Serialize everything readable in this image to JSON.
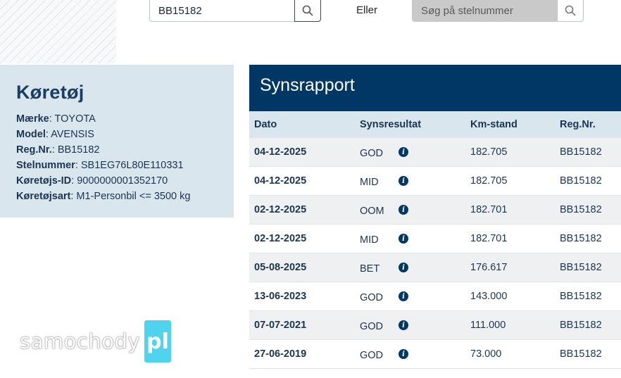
{
  "search": {
    "reg_value": "BB15182",
    "or_label": "Eller",
    "frame_placeholder": "Søg på stelnummer"
  },
  "vehicle": {
    "title": "Køretøj",
    "fields": [
      {
        "key": "Mærke",
        "value": "TOYOTA"
      },
      {
        "key": "Model",
        "value": "AVENSIS"
      },
      {
        "key": "Reg.Nr.",
        "value": "BB15182"
      },
      {
        "key": "Stelnummer",
        "value": "SB1EG76L80E110331"
      },
      {
        "key": "Køretøjs-ID",
        "value": "9000000001352170"
      },
      {
        "key": "Køretøjsart",
        "value": "M1-Personbil <= 3500 kg"
      }
    ]
  },
  "report": {
    "title": "Synsrapport",
    "columns": [
      "Dato",
      "Synsresultat",
      "Km-stand",
      "Reg.Nr."
    ],
    "rows": [
      {
        "date": "04-12-2025",
        "result": "GOD",
        "km": "182.705",
        "reg": "BB15182"
      },
      {
        "date": "04-12-2025",
        "result": "MID",
        "km": "182.705",
        "reg": "BB15182"
      },
      {
        "date": "02-12-2025",
        "result": "OOM",
        "km": "182.701",
        "reg": "BB15182"
      },
      {
        "date": "02-12-2025",
        "result": "MID",
        "km": "182.701",
        "reg": "BB15182"
      },
      {
        "date": "05-08-2025",
        "result": "BET",
        "km": "176.617",
        "reg": "BB15182"
      },
      {
        "date": "13-06-2023",
        "result": "GOD",
        "km": "143.000",
        "reg": "BB15182"
      },
      {
        "date": "07-07-2021",
        "result": "GOD",
        "km": "111.000",
        "reg": "BB15182"
      },
      {
        "date": "27-06-2019",
        "result": "GOD",
        "km": "73.000",
        "reg": "BB15182"
      }
    ]
  },
  "watermark": {
    "text": "samochody",
    "badge": "pl"
  },
  "colors": {
    "navy": "#003764",
    "panel": "#d9e6ee",
    "badge": "#4fd3ee"
  },
  "icons": [
    "search-icon",
    "info-icon"
  ]
}
